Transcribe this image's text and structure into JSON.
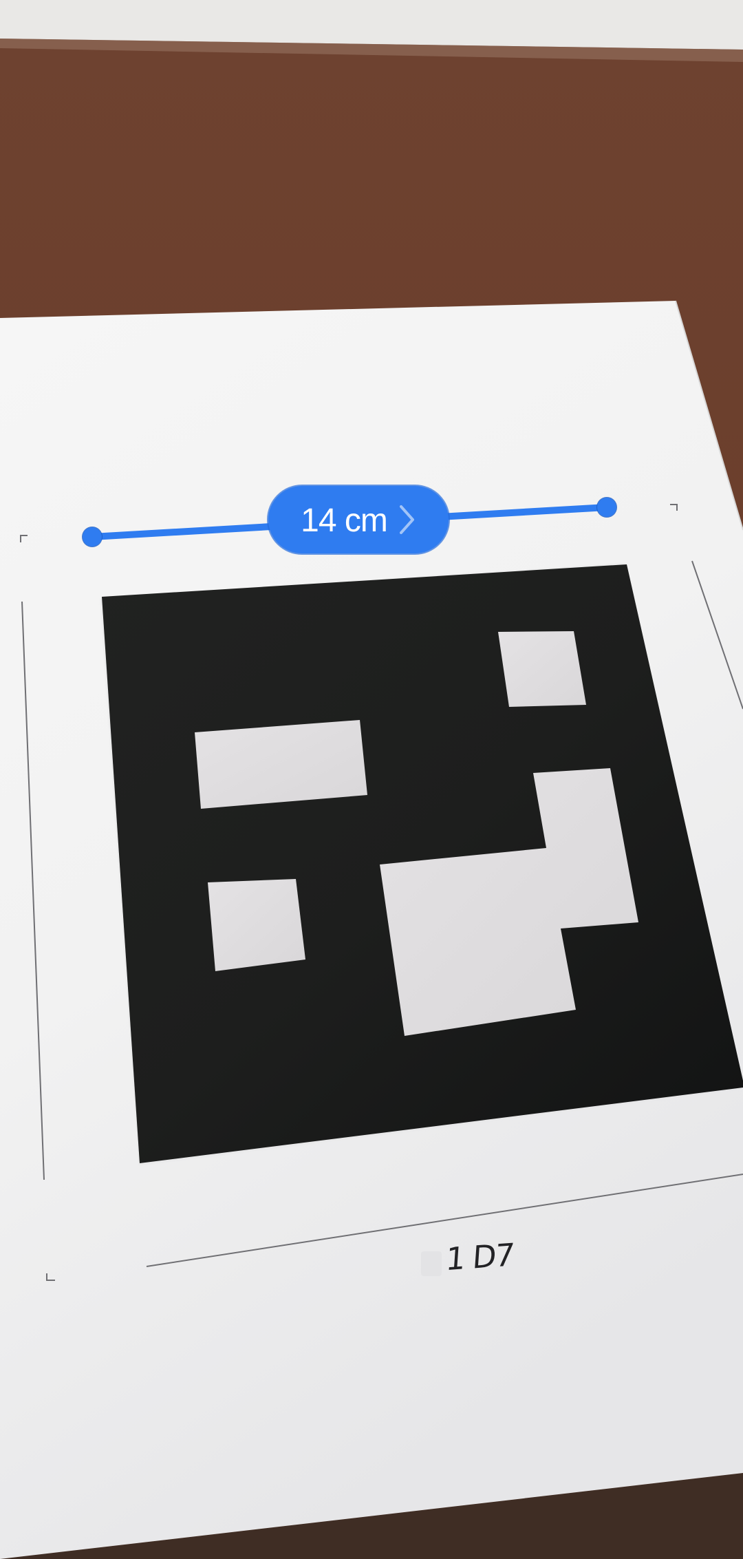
{
  "measurement": {
    "value_label": "14 cm",
    "action_icon": "chevron-right-icon",
    "line_color": "#2f7cf0"
  },
  "scene": {
    "marker_label": "1 D7",
    "table_color": "#6b3f2c",
    "paper_color": "#f1f0f0",
    "marker_color": "#1a1b1b"
  }
}
